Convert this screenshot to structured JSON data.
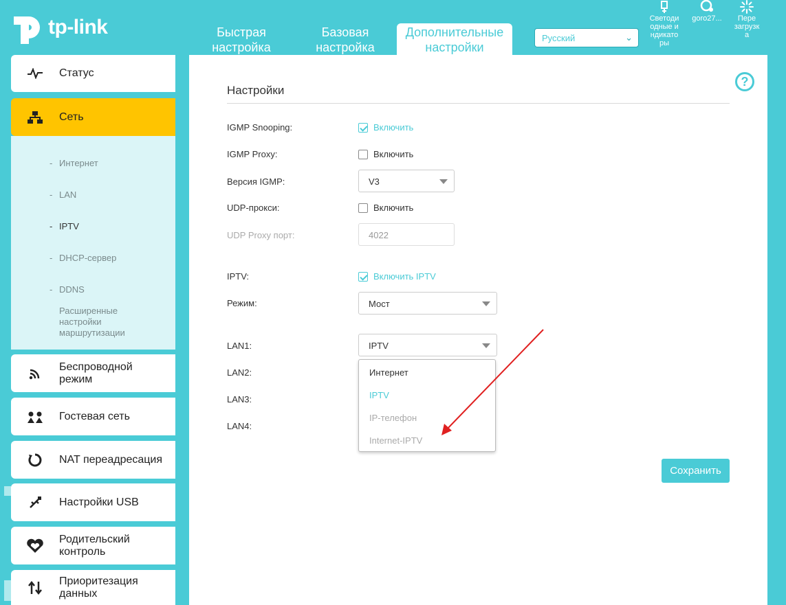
{
  "brand": {
    "name": "tp-link",
    "accent": "#4acbd6",
    "active_nav": "#ffc400"
  },
  "header": {
    "tabs": [
      {
        "label": "Быстрая настройка",
        "l1": "Быстрая",
        "l2": "настройка"
      },
      {
        "label": "Базовая настройка",
        "l1": "Базовая",
        "l2": "настройка"
      },
      {
        "label": "Дополнительные настройки",
        "l1": "Дополнительные",
        "l2": "настройки",
        "active": true
      }
    ],
    "language": "Русский",
    "icons": [
      {
        "name": "led-icon",
        "l1": "Светоди",
        "l2": "одные и",
        "l3": "ндикато",
        "l4": "ры"
      },
      {
        "name": "cloud-account-icon",
        "l1": "goro27..."
      },
      {
        "name": "reboot-icon",
        "l1": "Пере",
        "l2": "загрузк",
        "l3": "а"
      }
    ]
  },
  "sidebar": {
    "items": [
      {
        "label": "Статус",
        "icon": "pulse-icon"
      },
      {
        "label": "Сеть",
        "icon": "network-icon",
        "active": true
      },
      {
        "label": "Беспроводной режим",
        "l1": "Беспроводной",
        "l2": "режим",
        "icon": "wireless-icon"
      },
      {
        "label": "Гостевая сеть",
        "icon": "guest-network-icon"
      },
      {
        "label": "NAT переадресация",
        "icon": "nat-icon"
      },
      {
        "label": "Настройки USB",
        "icon": "usb-icon"
      },
      {
        "label": "Родительский контроль",
        "l1": "Родительский",
        "l2": "контроль",
        "icon": "parental-control-icon"
      },
      {
        "label": "Приоритезация данных",
        "l1": "Приоритезация",
        "l2": "данных",
        "icon": "qos-icon"
      }
    ],
    "subitems": [
      {
        "label": "Интернет"
      },
      {
        "label": "LAN"
      },
      {
        "label": "IPTV",
        "active": true
      },
      {
        "label": "DHCP-сервер"
      },
      {
        "label": "DDNS"
      },
      {
        "label": "Расширенные настройки маршрутизации",
        "l1": "Расширенные",
        "l2": "настройки",
        "l3": "маршрутизации"
      }
    ]
  },
  "settings": {
    "title": "Настройки",
    "igmp_snooping": {
      "label": "IGMP Snooping:",
      "check_label": "Включить",
      "checked": true
    },
    "igmp_proxy": {
      "label": "IGMP Proxy:",
      "check_label": "Включить",
      "checked": false
    },
    "igmp_version": {
      "label": "Версия IGMP:",
      "value": "V3"
    },
    "udp_proxy": {
      "label": "UDP-прокси:",
      "check_label": "Включить",
      "checked": false
    },
    "udp_proxy_port": {
      "label": "UDP Proxy порт:",
      "value": "4022"
    },
    "iptv": {
      "label": "IPTV:",
      "check_label": "Включить IPTV",
      "checked": true
    },
    "mode": {
      "label": "Режим:",
      "value": "Мост"
    },
    "lan1": {
      "label": "LAN1:",
      "value": "IPTV"
    },
    "lan2": {
      "label": "LAN2:"
    },
    "lan3": {
      "label": "LAN3:"
    },
    "lan4": {
      "label": "LAN4:"
    },
    "dropdown_options": [
      {
        "label": "Интернет",
        "state": "normal"
      },
      {
        "label": "IPTV",
        "state": "selected"
      },
      {
        "label": "IP-телефон",
        "state": "disabled"
      },
      {
        "label": "Internet-IPTV",
        "state": "disabled"
      }
    ],
    "save_label": "Сохранить"
  },
  "annotation": {
    "arrow_color": "#e02020"
  }
}
